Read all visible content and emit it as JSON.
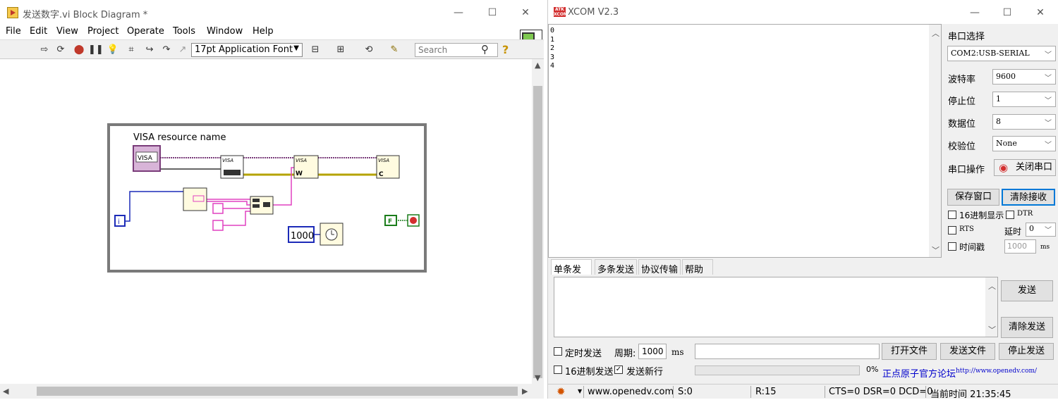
{
  "labview": {
    "title": "发送数字.vi Block Diagram *",
    "window_controls": {
      "minimize": "—",
      "maximize": "☐",
      "close": "✕"
    },
    "menu": [
      "File",
      "Edit",
      "View",
      "Project",
      "Operate",
      "Tools",
      "Window",
      "Help"
    ],
    "font_select": "17pt Application Font",
    "search_placeholder": "Search",
    "diagram": {
      "visa_label": "VISA resource name",
      "visa_const": "VISA",
      "wait_ms": "1000",
      "i_terminal": "i",
      "false_const": "F",
      "visa_serial_label": "VISA",
      "visa_write_label": "VISA",
      "visa_close_label": "VISA"
    }
  },
  "xcom": {
    "title": "XCOM V2.3",
    "window_controls": {
      "minimize": "—",
      "maximize": "☐",
      "close": "✕"
    },
    "receive_text": "0\n1\n2\n3\n4",
    "port_select_label": "串口选择",
    "port_value": "COM2:USB-SERIAL",
    "baud_label": "波特率",
    "baud_value": "9600",
    "stop_label": "停止位",
    "stop_value": "1",
    "data_label": "数据位",
    "data_value": "8",
    "parity_label": "校验位",
    "parity_value": "None",
    "op_label": "串口操作",
    "close_port_btn": "关闭串口",
    "save_window_btn": "保存窗口",
    "clear_recv_btn": "清除接收",
    "hex_display": "16进制显示",
    "dtr": "DTR",
    "rts": "RTS",
    "delay_label": "延时",
    "delay_value": "0",
    "timestamp": "时间戳",
    "timestamp_value": "1000",
    "ms": "ms",
    "tabs": [
      "单条发送",
      "多条发送",
      "协议传输",
      "帮助"
    ],
    "send_btn": "发送",
    "clear_send_btn": "清除发送",
    "timed_send": "定时发送",
    "period_label": "周期:",
    "period_value": "1000",
    "period_unit": "ms",
    "open_file_btn": "打开文件",
    "send_file_btn": "发送文件",
    "stop_send_btn": "停止发送",
    "hex_send": "16进制发送",
    "send_newline": "发送新行",
    "progress": "0%",
    "forum_text": "正点原子官方论坛",
    "forum_url": "http://www.openedv.com/",
    "status": {
      "site": "www.openedv.com",
      "s": "S:0",
      "r": "R:15",
      "lines": "CTS=0 DSR=0 DCD=0",
      "time": "当前时间 21:35:45"
    }
  }
}
